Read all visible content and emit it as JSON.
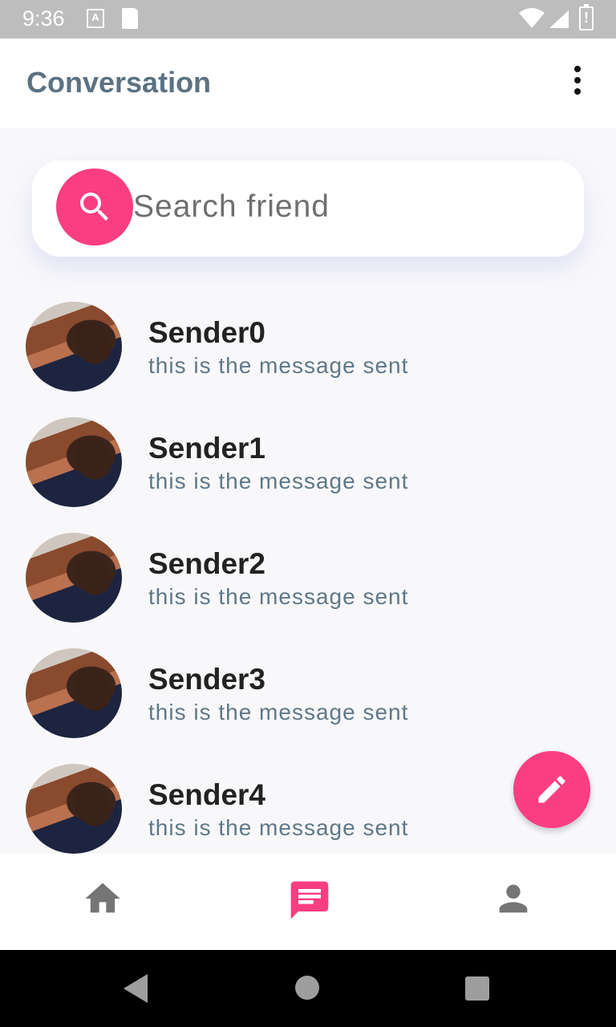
{
  "status_bar": {
    "time": "9:36",
    "notification_icons": [
      "text-a-icon",
      "sd-card-icon"
    ],
    "system_icons": [
      "wifi-icon",
      "signal-icon",
      "battery-alert-icon"
    ]
  },
  "app_bar": {
    "title": "Conversation",
    "menu_icon": "more-vert-icon"
  },
  "search": {
    "placeholder": "Search friend",
    "value": "",
    "icon": "search-icon"
  },
  "conversations": [
    {
      "name": "Sender0",
      "message": "this is the message sent"
    },
    {
      "name": "Sender1",
      "message": "this is the message sent"
    },
    {
      "name": "Sender2",
      "message": "this is the message sent"
    },
    {
      "name": "Sender3",
      "message": "this is the message sent"
    },
    {
      "name": "Sender4",
      "message": "this is the message sent"
    }
  ],
  "fab": {
    "icon": "edit-icon"
  },
  "bottom_nav": {
    "items": [
      {
        "icon": "home-icon",
        "active": false
      },
      {
        "icon": "chat-icon",
        "active": true
      },
      {
        "icon": "person-icon",
        "active": false
      }
    ]
  },
  "colors": {
    "accent": "#fb3e81",
    "title": "#5b7283",
    "message_text": "#5f7888",
    "inactive_icon": "#757575",
    "background": "#f8f8fa"
  }
}
